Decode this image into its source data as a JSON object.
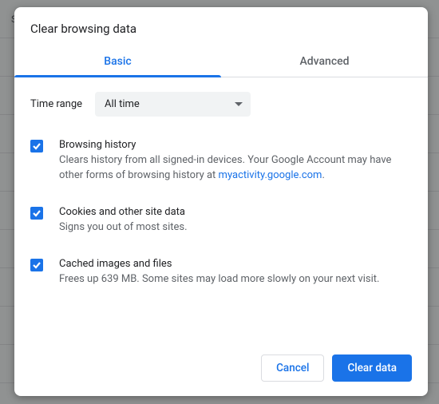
{
  "background": {
    "rows": [
      "Sync",
      "",
      "",
      "",
      "",
      "",
      "",
      "",
      ""
    ]
  },
  "dialog": {
    "title": "Clear browsing data",
    "tabs": {
      "basic": "Basic",
      "advanced": "Advanced",
      "active": "basic"
    },
    "time_range": {
      "label": "Time range",
      "value": "All time"
    },
    "options": [
      {
        "title": "Browsing history",
        "desc_pre": "Clears history from all signed-in devices. Your Google Account may have other forms of browsing history at ",
        "link_text": "myactivity.google.com",
        "desc_post": ".",
        "checked": true
      },
      {
        "title": "Cookies and other site data",
        "desc_pre": "Signs you out of most sites.",
        "link_text": "",
        "desc_post": "",
        "checked": true
      },
      {
        "title": "Cached images and files",
        "desc_pre": "Frees up 639 MB. Some sites may load more slowly on your next visit.",
        "link_text": "",
        "desc_post": "",
        "checked": true
      }
    ],
    "buttons": {
      "cancel": "Cancel",
      "clear": "Clear data"
    }
  }
}
